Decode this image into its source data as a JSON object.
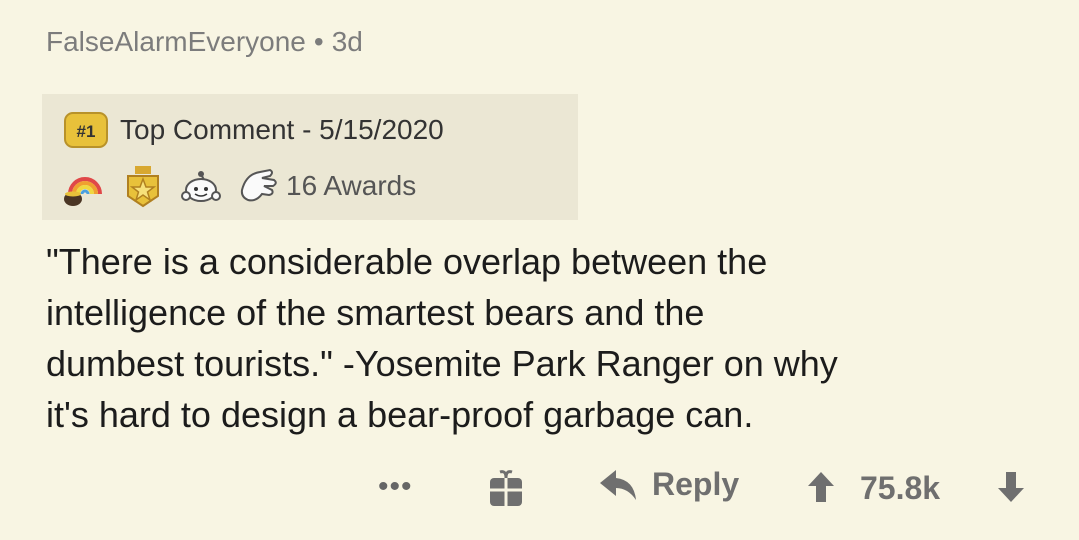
{
  "comment": {
    "author": "FalseAlarmEveryone",
    "separator": "•",
    "age": "3d",
    "rank_badge": "#1",
    "top_comment_label": "Top Comment - 5/15/2020",
    "awards": [
      {
        "icon": "rainbow-pot-award-icon"
      },
      {
        "icon": "gold-medal-star-award-icon"
      },
      {
        "icon": "hugz-snoo-award-icon"
      },
      {
        "icon": "wholesome-hand-award-icon"
      }
    ],
    "awards_count_label": "16 Awards",
    "body_lines": [
      "\"There is a considerable overlap between the",
      "intelligence of the smartest bears and the",
      "dumbest tourists.\"  -Yosemite Park Ranger on why",
      "it's hard to design a bear-proof garbage can."
    ]
  },
  "actions": {
    "more_label": "•••",
    "gift_icon": "gift-icon",
    "reply_icon": "reply-arrow-icon",
    "reply_label": "Reply",
    "upvote_icon": "upvote-arrow-icon",
    "score": "75.8k",
    "downvote_icon": "downvote-arrow-icon"
  },
  "colors": {
    "background": "#f8f5e3",
    "award_box": "#ebe7d4",
    "meta_text": "#7c7c7c",
    "action_text": "#6f6f6f",
    "badge_gold": "#e8c13a"
  }
}
